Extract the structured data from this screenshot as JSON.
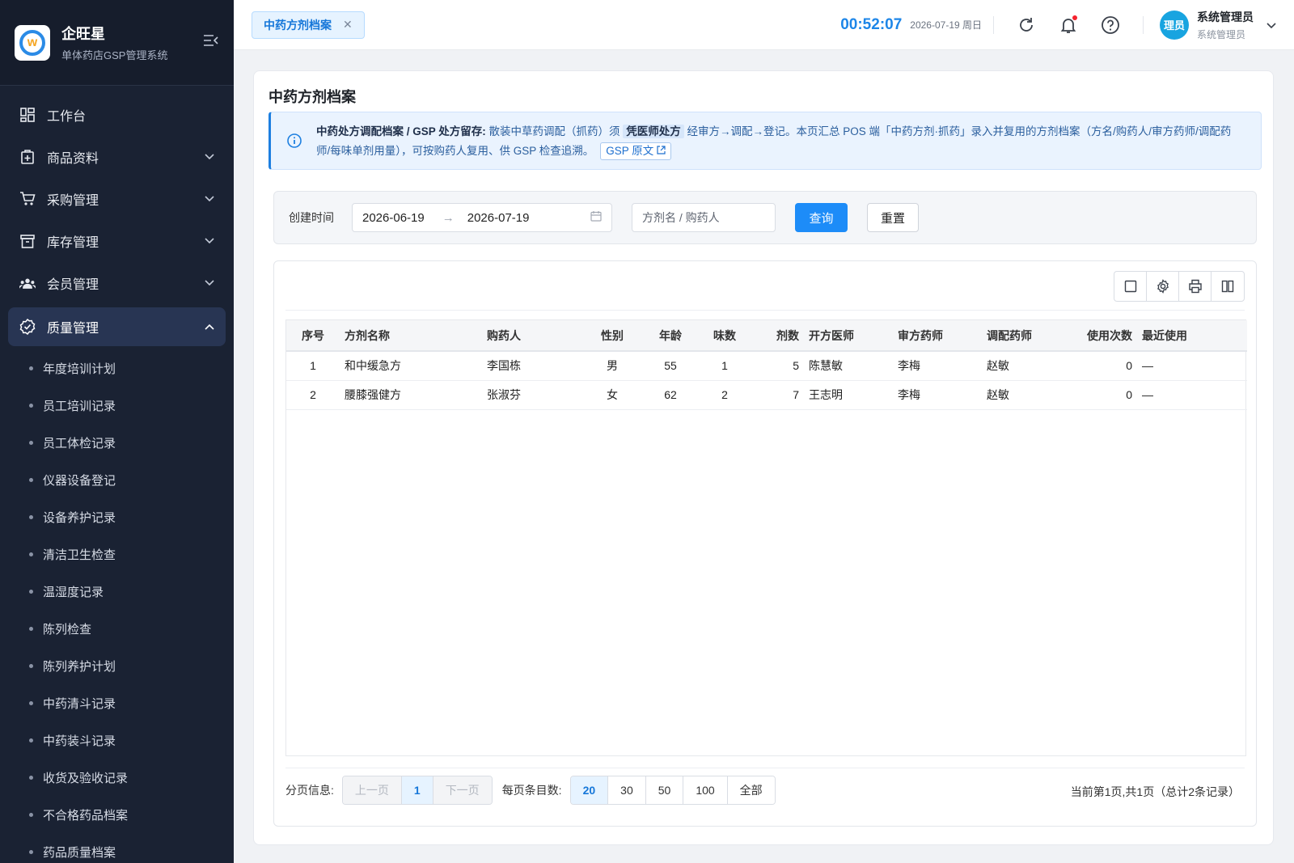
{
  "brand": {
    "name": "企旺星",
    "subtitle": "单体药店GSP管理系统"
  },
  "sidebar": {
    "items": [
      {
        "label": "工作台",
        "icon": "dashboard-icon"
      },
      {
        "label": "商品资料",
        "icon": "goods-icon"
      },
      {
        "label": "采购管理",
        "icon": "cart-icon"
      },
      {
        "label": "库存管理",
        "icon": "inventory-icon"
      },
      {
        "label": "会员管理",
        "icon": "members-icon"
      },
      {
        "label": "质量管理",
        "icon": "quality-icon"
      }
    ],
    "sub_items": [
      "年度培训计划",
      "员工培训记录",
      "员工体检记录",
      "仪器设备登记",
      "设备养护记录",
      "清洁卫生检查",
      "温湿度记录",
      "陈列检查",
      "陈列养护计划",
      "中药清斗记录",
      "中药装斗记录",
      "收货及验收记录",
      "不合格药品档案",
      "药品质量档案"
    ]
  },
  "topbar": {
    "tab_label": "中药方剂档案",
    "clock": "00:52:07",
    "date": "2026-07-19 周日",
    "avatar_text": "理员",
    "user_name": "系统管理员",
    "user_role": "系统管理员"
  },
  "page": {
    "title": "中药方剂档案",
    "notice": {
      "bold": "中药处方调配档案 / GSP 处方留存:",
      "text1": " 散装中草药调配（抓药）须 ",
      "highlight": "凭医师处方",
      "text2": " 经审方→调配→登记。本页汇总 POS 端「中药方剂·抓药」录入并复用的方剂档案（方名/购药人/审方药师/调配药师/每味单剂用量），可按购药人复用、供 GSP 检查追溯。",
      "link": "GSP 原文"
    }
  },
  "filter": {
    "label": "创建时间",
    "date_start": "2026-06-19",
    "date_end": "2026-07-19",
    "search_placeholder": "方剂名 / 购药人",
    "query_label": "查询",
    "reset_label": "重置"
  },
  "table": {
    "columns": [
      "序号",
      "方剂名称",
      "购药人",
      "性别",
      "年龄",
      "味数",
      "剂数",
      "开方医师",
      "审方药师",
      "调配药师",
      "使用次数",
      "最近使用"
    ],
    "rows": [
      [
        "1",
        "和中缓急方",
        "李国栋",
        "男",
        "55",
        "1",
        "5",
        "陈慧敏",
        "李梅",
        "赵敏",
        "0",
        "—"
      ],
      [
        "2",
        "腰膝强健方",
        "张淑芬",
        "女",
        "62",
        "2",
        "7",
        "王志明",
        "李梅",
        "赵敏",
        "0",
        "—"
      ]
    ]
  },
  "pager": {
    "label": "分页信息:",
    "prev": "上一页",
    "current": "1",
    "next": "下一页",
    "size_label": "每页条目数:",
    "sizes": [
      "20",
      "30",
      "50",
      "100",
      "全部"
    ],
    "info": "当前第1页,共1页（总计2条记录）"
  }
}
